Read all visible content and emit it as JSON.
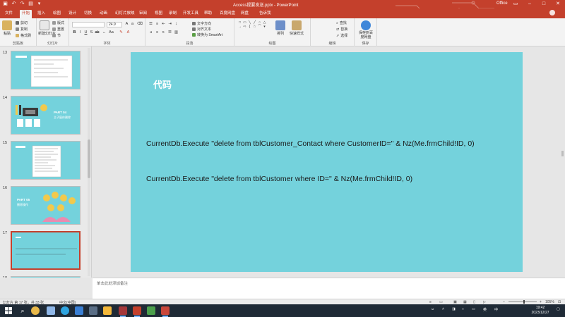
{
  "app": {
    "doc_title": "Access提要发送.pptx - PowerPoint",
    "office_label": "Office"
  },
  "tabs": [
    "文件",
    "开始",
    "插入",
    "绘图",
    "设计",
    "切换",
    "动画",
    "幻灯片放映",
    "审阅",
    "视图",
    "录制",
    "开发工具",
    "帮助",
    "百度网盘",
    "网盘",
    "告诉我"
  ],
  "ribbon": {
    "groups": [
      "剪贴板",
      "幻灯片",
      "字体",
      "段落",
      "绘图",
      "编辑",
      "保存"
    ],
    "paste": "粘贴",
    "new_slide": "新建幻灯片",
    "cut": "剪切",
    "copy": "复制",
    "format_painter": "格式刷",
    "layout": "版式",
    "reset": "重置",
    "section": "节",
    "font_name": "",
    "font_size": "24.9",
    "text_direction": "文字方向",
    "align_text": "对齐文本",
    "smartart": "转换为 SmartArt",
    "arrange": "排列",
    "quick_styles": "快速样式",
    "find": "查找",
    "replace": "替换",
    "select": "选择",
    "save_to_cloud": "保存到百度网盘"
  },
  "thumbnails": [
    {
      "num": "13"
    },
    {
      "num": "14",
      "title": "PART 04",
      "subtitle": "主子窗体删除"
    },
    {
      "num": "15"
    },
    {
      "num": "16",
      "title": "PART 05",
      "subtitle": "删除操作"
    },
    {
      "num": "17"
    },
    {
      "num": "18"
    }
  ],
  "slide": {
    "title": "代码",
    "lines": [
      "CurrentDb.Execute \"delete from  tblCustomer_Contact where  CustomerID=\" & Nz(Me.frmChild!ID, 0)",
      "CurrentDb.Execute \"delete from  tblCustomer where  ID=\" & Nz(Me.frmChild!ID, 0)"
    ]
  },
  "notes": {
    "placeholder": "单击此处添加备注"
  },
  "status": {
    "slide_info": "幻灯片 第 17 张，共 33 张",
    "language": "中文(中国)",
    "zoom": "105%"
  },
  "taskbar": {
    "time": "19:42",
    "date": "2023/12/27"
  },
  "colors": {
    "accent": "#c4402c",
    "slide_bg": "#74d2dc"
  }
}
